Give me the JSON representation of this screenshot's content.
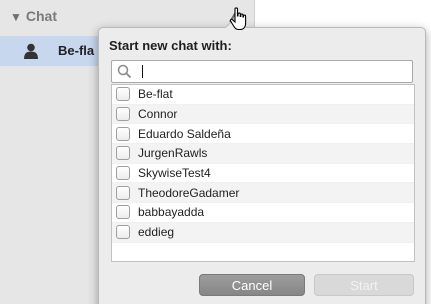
{
  "sidebar": {
    "header": {
      "label": "Chat",
      "expand_icon": "disclosure-triangle-down-icon"
    },
    "items": [
      {
        "label": "Be-fla",
        "icon": "person-icon"
      }
    ],
    "add_icon": "add-chat-icon"
  },
  "popover": {
    "title": "Start new chat with:",
    "search": {
      "value": "",
      "placeholder": "",
      "icon": "search-icon"
    },
    "users": [
      "Be-flat",
      "Connor",
      "Eduardo Saldeña",
      "JurgenRawls",
      "SkywiseTest4",
      "TheodoreGadamer",
      "babbayadda",
      "eddieg"
    ],
    "buttons": {
      "cancel": "Cancel",
      "start": "Start"
    }
  },
  "colors": {
    "sidebar_bg": "#e6e6e6",
    "selected_row": "#c7d7ee",
    "popover_bg": "#ececec",
    "cancel_button": "#8f8f8f",
    "start_button_disabled": "#d9d9d9"
  }
}
